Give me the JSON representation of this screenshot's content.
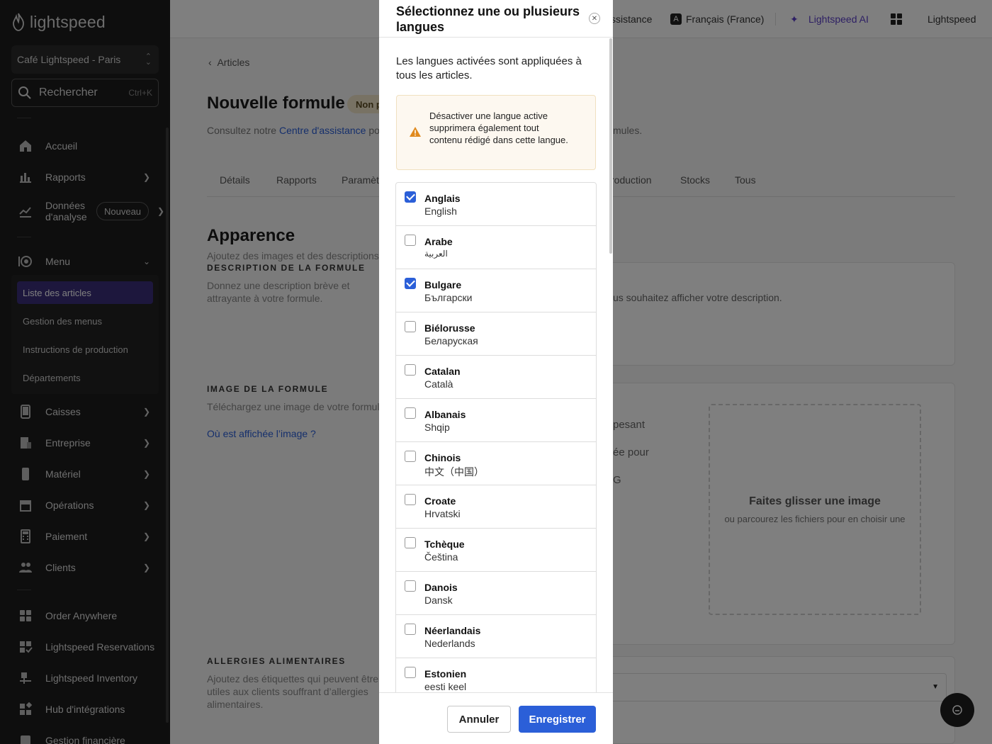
{
  "sidebar": {
    "logo": "lightspeed",
    "store": "Café Lightspeed - Paris",
    "search_label": "Rechercher",
    "search_shortcut": "Ctrl+K",
    "items": [
      {
        "label": "Accueil",
        "icon": "home-icon"
      },
      {
        "label": "Rapports",
        "icon": "bar-chart-icon"
      },
      {
        "label": "Données d'analyse",
        "icon": "trend-icon",
        "badge": "Nouveau"
      },
      {
        "label": "Menu",
        "icon": "menu-icon"
      },
      {
        "label": "Caisses",
        "icon": "tablet-icon"
      },
      {
        "label": "Entreprise",
        "icon": "building-icon"
      },
      {
        "label": "Matériel",
        "icon": "device-icon"
      },
      {
        "label": "Opérations",
        "icon": "archive-icon"
      },
      {
        "label": "Paiement",
        "icon": "calculator-icon"
      },
      {
        "label": "Clients",
        "icon": "users-icon"
      },
      {
        "label": "Order Anywhere",
        "icon": "grid-icon"
      },
      {
        "label": "Lightspeed Reservations",
        "icon": "calendar-check-icon"
      },
      {
        "label": "Lightspeed Inventory",
        "icon": "inventory-icon"
      },
      {
        "label": "Hub d'intégrations",
        "icon": "apps-icon"
      },
      {
        "label": "Gestion financière",
        "icon": "finance-icon"
      }
    ],
    "menu_sub": [
      "Liste des articles",
      "Gestion des menus",
      "Instructions de production",
      "Départements"
    ]
  },
  "topbar": {
    "assistance": "ssistance",
    "language": "Français (France)",
    "language_icon": "A",
    "ai": "Lightspeed AI",
    "account": "Lightspeed"
  },
  "main": {
    "breadcrumb": "Articles",
    "title": "Nouvelle formule",
    "status": "Non p",
    "help_prefix": "Consultez notre ",
    "help_link": "Centre d'assistance",
    "help_suffix": " po",
    "help_tail": "mules.",
    "tabs": [
      "Détails",
      "Rapports",
      "Paramèt",
      "roduction",
      "Stocks",
      "Tous"
    ],
    "appearance_title": "Apparence",
    "appearance_desc": "Ajoutez des images et des descriptions p",
    "desc_label": "DESCRIPTION DE LA FORMULE",
    "desc_text": "Donnez une description brève et attrayante à votre formule.",
    "desc_hint": "us souhaitez afficher votre description.",
    "image_label": "IMAGE DE LA FORMULE",
    "image_text": "Téléchargez une image de votre formule",
    "image_link": "Où est affichée l’image ?",
    "image_hint_1": "pesant",
    "image_hint_2": "ée pour",
    "image_hint_3": "G",
    "drop_title": "Faites glisser une image",
    "drop_sub": "ou parcourez les fichiers pour en choisir une",
    "allergy_label": "ALLERGIES ALIMENTAIRES",
    "allergy_text": "Ajoutez des étiquettes qui peuvent être utiles aux clients souffrant d’allergies alimentaires."
  },
  "modal": {
    "title": "Sélectionnez une ou plusieurs langues",
    "intro": "Les langues activées sont appliquées à tous les articles.",
    "warning": "Désactiver une langue active supprimera également tout contenu rédigé dans cette langue.",
    "languages": [
      {
        "name": "Anglais",
        "native": "English",
        "checked": true
      },
      {
        "name": "Arabe",
        "native": "العربية",
        "checked": false
      },
      {
        "name": "Bulgare",
        "native": "Български",
        "checked": true
      },
      {
        "name": "Biélorusse",
        "native": "Беларуская",
        "checked": false
      },
      {
        "name": "Catalan",
        "native": "Català",
        "checked": false
      },
      {
        "name": "Albanais",
        "native": "Shqip",
        "checked": false
      },
      {
        "name": "Chinois",
        "native": "中文（中国）",
        "checked": false
      },
      {
        "name": "Croate",
        "native": "Hrvatski",
        "checked": false
      },
      {
        "name": "Tchèque",
        "native": "Čeština",
        "checked": false
      },
      {
        "name": "Danois",
        "native": "Dansk",
        "checked": false
      },
      {
        "name": "Néerlandais",
        "native": "Nederlands",
        "checked": false
      },
      {
        "name": "Estonien",
        "native": "eesti keel",
        "checked": false
      }
    ],
    "cancel": "Annuler",
    "save": "Enregistrer"
  },
  "colors": {
    "accent": "#2b5fd8",
    "sidebar": "#1c1c1c",
    "active_item": "#3a2f7a",
    "ai": "#5b3ec8"
  }
}
